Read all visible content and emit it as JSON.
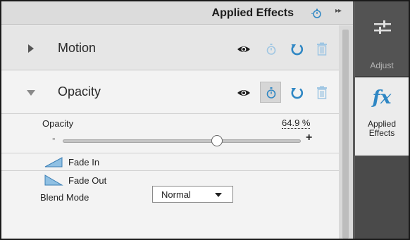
{
  "header": {
    "title": "Applied Effects",
    "left_icon": "stopwatch-small-icon",
    "right_icon": "double-chevron-right-icon"
  },
  "effects": [
    {
      "name": "Motion",
      "expanded": false,
      "icons": [
        "eye-icon",
        "stopwatch-icon",
        "reset-icon",
        "trash-icon"
      ]
    },
    {
      "name": "Opacity",
      "expanded": true,
      "icons": [
        "eye-icon",
        "stopwatch-icon",
        "reset-icon",
        "trash-icon"
      ],
      "stopwatch_active": true
    }
  ],
  "opacity": {
    "label": "Opacity",
    "value": "64.9 %",
    "slider_fraction": 0.649,
    "minus": "-",
    "plus": "+"
  },
  "fade_in": {
    "label": "Fade In",
    "icon": "fade-in-icon"
  },
  "fade_out": {
    "label": "Fade Out",
    "icon": "fade-out-icon"
  },
  "blend": {
    "label": "Blend Mode",
    "value": "Normal"
  },
  "sidebar": {
    "adjust": {
      "label": "Adjust",
      "icon": "sliders-icon"
    },
    "applied_effects": {
      "label_line1": "Applied",
      "label_line2": "Effects",
      "icon_text": "fx"
    }
  },
  "colors": {
    "accent": "#2f87c4",
    "sidebar_dark": "#4a4a4a",
    "panel_bg": "#f2f2f2"
  }
}
